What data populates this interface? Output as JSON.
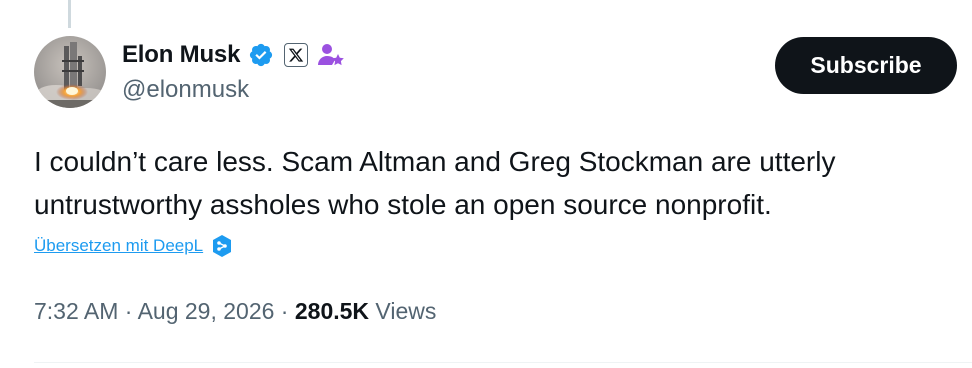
{
  "author": {
    "display_name": "Elon Musk",
    "handle": "@elonmusk",
    "avatar_icon": "rocket-launch-avatar",
    "verified_icon": "verified-badge-icon",
    "brand_icon": "x-logo-icon",
    "affiliate_icon": "affiliate-person-star-icon"
  },
  "actions": {
    "subscribe_label": "Subscribe"
  },
  "tweet": {
    "text_lines": [
      "I couldn’t care less. Scam Altman and Greg Stockman are utterly",
      "untrustworthy assholes who stole an open source nonprofit."
    ],
    "translate_label": "Übersetzen mit DeepL",
    "translate_icon": "deepl-icon"
  },
  "meta": {
    "time": "7:32 AM",
    "separator": " · ",
    "date": "Aug 29, 2026",
    "views_count": "280.5K",
    "views_label": "Views"
  },
  "colors": {
    "primary_text": "#0f1419",
    "secondary_text": "#536471",
    "link": "#1d9bf0",
    "verified": "#1d9bf0",
    "button_bg": "#0f1419",
    "affiliate": "#9b51e0"
  }
}
